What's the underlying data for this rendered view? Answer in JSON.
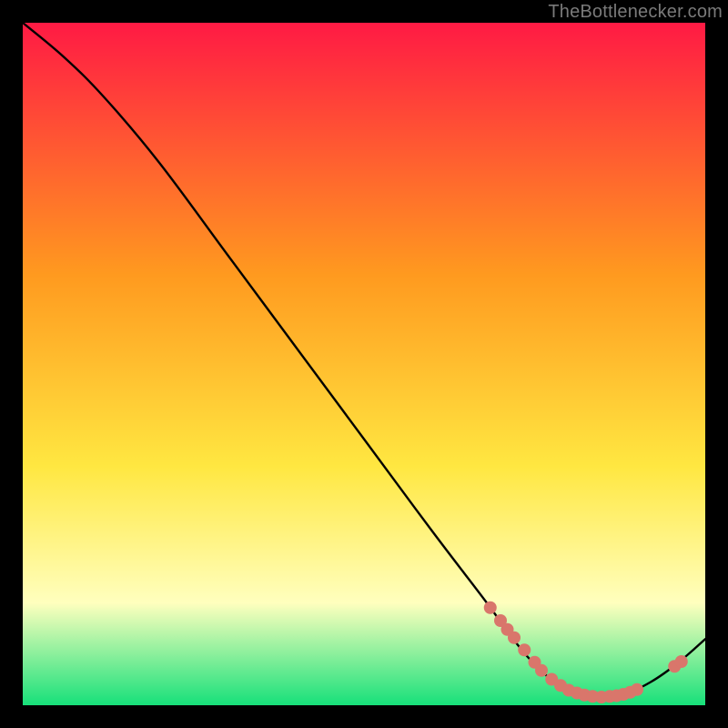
{
  "attribution": "TheBottlenecker.com",
  "colors": {
    "grad_red": "#ff1a44",
    "grad_orange": "#ff9a1f",
    "grad_yellow": "#ffe741",
    "grad_paleyellow": "#ffffbe",
    "grad_green": "#17e07a",
    "curve": "#000000",
    "marker": "#d9766b",
    "frame": "#000000"
  },
  "chart_data": {
    "type": "line",
    "title": "",
    "xlabel": "",
    "ylabel": "",
    "xlim": [
      0,
      100
    ],
    "ylim": [
      0,
      100
    ],
    "series": [
      {
        "name": "curve",
        "values": [
          {
            "x": 0,
            "y": 100
          },
          {
            "x": 6,
            "y": 95
          },
          {
            "x": 12,
            "y": 89
          },
          {
            "x": 20,
            "y": 79.5
          },
          {
            "x": 30,
            "y": 66
          },
          {
            "x": 40,
            "y": 52.5
          },
          {
            "x": 50,
            "y": 39
          },
          {
            "x": 60,
            "y": 25.5
          },
          {
            "x": 68,
            "y": 15
          },
          {
            "x": 72,
            "y": 9.5
          },
          {
            "x": 76,
            "y": 5
          },
          {
            "x": 80,
            "y": 2.2
          },
          {
            "x": 84,
            "y": 1.2
          },
          {
            "x": 88,
            "y": 1.6
          },
          {
            "x": 92,
            "y": 3.4
          },
          {
            "x": 96,
            "y": 6.2
          },
          {
            "x": 100,
            "y": 9.7
          }
        ]
      }
    ],
    "markers": [
      {
        "x": 68.5,
        "y": 14.3
      },
      {
        "x": 70.0,
        "y": 12.4
      },
      {
        "x": 71.0,
        "y": 11.1
      },
      {
        "x": 72.0,
        "y": 9.9
      },
      {
        "x": 73.5,
        "y": 8.1
      },
      {
        "x": 75.0,
        "y": 6.3
      },
      {
        "x": 76.0,
        "y": 5.1
      },
      {
        "x": 77.5,
        "y": 3.8
      },
      {
        "x": 78.8,
        "y": 2.9
      },
      {
        "x": 80.0,
        "y": 2.2
      },
      {
        "x": 81.2,
        "y": 1.8
      },
      {
        "x": 82.3,
        "y": 1.5
      },
      {
        "x": 83.5,
        "y": 1.3
      },
      {
        "x": 84.8,
        "y": 1.2
      },
      {
        "x": 86.0,
        "y": 1.3
      },
      {
        "x": 87.0,
        "y": 1.4
      },
      {
        "x": 88.0,
        "y": 1.6
      },
      {
        "x": 89.0,
        "y": 1.9
      },
      {
        "x": 90.0,
        "y": 2.3
      },
      {
        "x": 95.5,
        "y": 5.7
      },
      {
        "x": 96.5,
        "y": 6.4
      }
    ]
  }
}
